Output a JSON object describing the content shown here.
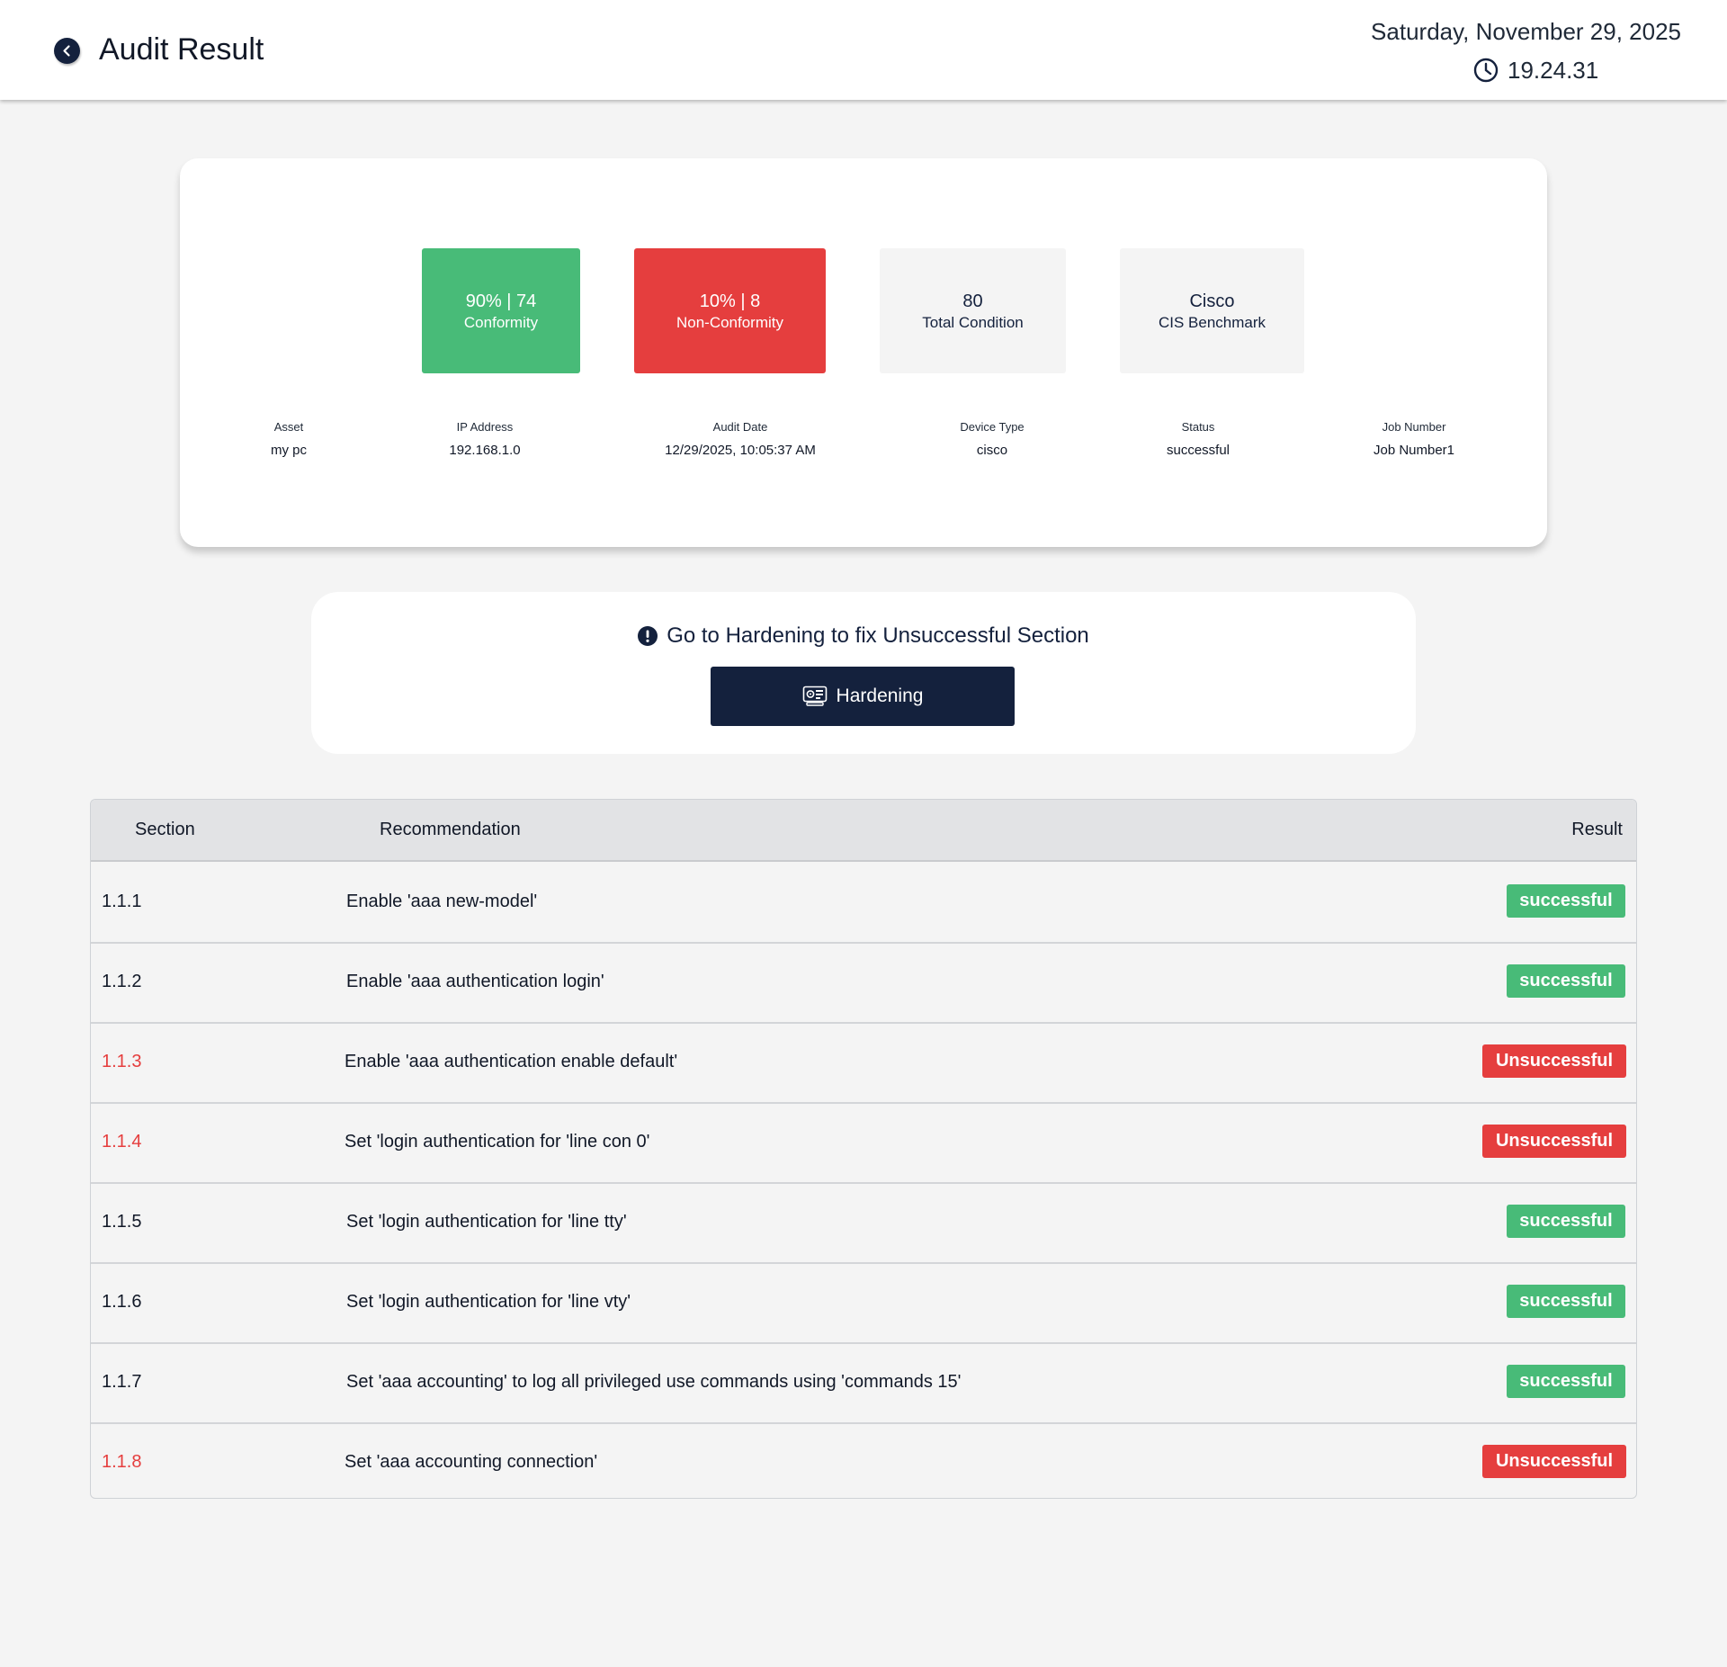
{
  "header": {
    "title": "Audit Result",
    "date": "Saturday, November 29, 2025",
    "time": "19.24.31"
  },
  "stats": {
    "conformity": {
      "value": "90% | 74",
      "label": "Conformity",
      "percent": 90,
      "count": 74
    },
    "non_conformity": {
      "value": "10% | 8",
      "label": "Non-Conformity",
      "percent": 10,
      "count": 8
    },
    "total": {
      "value": "80",
      "label": "Total Condition"
    },
    "benchmark": {
      "value": "Cisco",
      "label": "CIS Benchmark"
    }
  },
  "info": {
    "asset": {
      "label": "Asset",
      "value": "my pc"
    },
    "ip": {
      "label": "IP Address",
      "value": "192.168.1.0"
    },
    "audit_date": {
      "label": "Audit Date",
      "value": "12/29/2025, 10:05:37 AM"
    },
    "device_type": {
      "label": "Device Type",
      "value": "cisco"
    },
    "status": {
      "label": "Status",
      "value": "successful"
    },
    "job_number": {
      "label": "Job Number",
      "value": "Job Number1"
    }
  },
  "notice": {
    "text": "Go to Hardening to fix Unsuccessful Section",
    "button_label": "Hardening"
  },
  "table": {
    "headers": {
      "section": "Section",
      "recommendation": "Recommendation",
      "result": "Result"
    },
    "rows": [
      {
        "section": "1.1.1",
        "recommendation": "Enable 'aaa new-model'",
        "result": "successful"
      },
      {
        "section": "1.1.2",
        "recommendation": "Enable 'aaa authentication login'",
        "result": "successful"
      },
      {
        "section": "1.1.3",
        "recommendation": "Enable 'aaa authentication enable default'",
        "result": "Unsuccessful"
      },
      {
        "section": "1.1.4",
        "recommendation": "Set 'login authentication for 'line con 0'",
        "result": "Unsuccessful"
      },
      {
        "section": "1.1.5",
        "recommendation": "Set 'login authentication for 'line tty'",
        "result": "successful"
      },
      {
        "section": "1.1.6",
        "recommendation": "Set 'login authentication for 'line vty'",
        "result": "successful"
      },
      {
        "section": "1.1.7",
        "recommendation": "Set 'aaa accounting' to log all privileged use commands using 'commands 15'",
        "result": "successful"
      },
      {
        "section": "1.1.8",
        "recommendation": "Set 'aaa accounting connection'",
        "result": "Unsuccessful"
      }
    ]
  },
  "colors": {
    "success": "#48bb78",
    "failure": "#e53e3e",
    "primary": "#14213d"
  },
  "icons": {
    "back": "chevron-left-icon",
    "clock": "clock-icon",
    "alert": "exclamation-circle-icon",
    "hardening": "machine-icon"
  }
}
